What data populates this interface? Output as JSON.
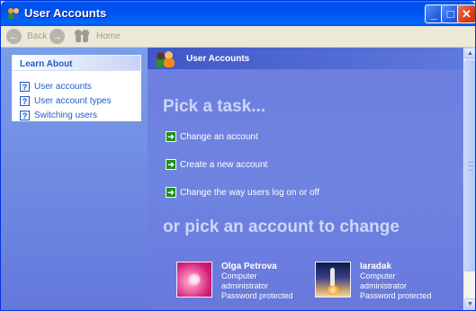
{
  "window": {
    "title": "User Accounts"
  },
  "titlebar_buttons": {
    "minimize": "_",
    "maximize": "□",
    "close": "✕"
  },
  "toolbar": {
    "back_label": "Back",
    "forward_icon": "forward-arrow-icon",
    "home_label": "Home"
  },
  "learn_about": {
    "heading": "Learn About",
    "items": [
      {
        "label": "User accounts"
      },
      {
        "label": "User account types"
      },
      {
        "label": "Switching users"
      }
    ]
  },
  "main": {
    "header_title": "User Accounts",
    "pick_task_heading": "Pick a task...",
    "tasks": [
      {
        "label": "Change an account"
      },
      {
        "label": "Create a new account"
      },
      {
        "label": "Change the way users log on or off"
      }
    ],
    "pick_account_heading": "or pick an account to change",
    "accounts": [
      {
        "name": "Olga Petrova",
        "type_line1": "Computer",
        "type_line2": "administrator",
        "status": "Password protected",
        "picture": "pink-flower"
      },
      {
        "name": "Iaradak",
        "type_line1": "Computer",
        "type_line2": "administrator",
        "status": "Password protected",
        "picture": "space-shuttle"
      }
    ]
  },
  "colors": {
    "titlebar": "#0055e5",
    "left_pane": "#7a9ee8",
    "main_pane": "#6c7edf",
    "link": "#215dc6",
    "heading": "#ccd6f7",
    "task_arrow": "#1c8f1c"
  }
}
